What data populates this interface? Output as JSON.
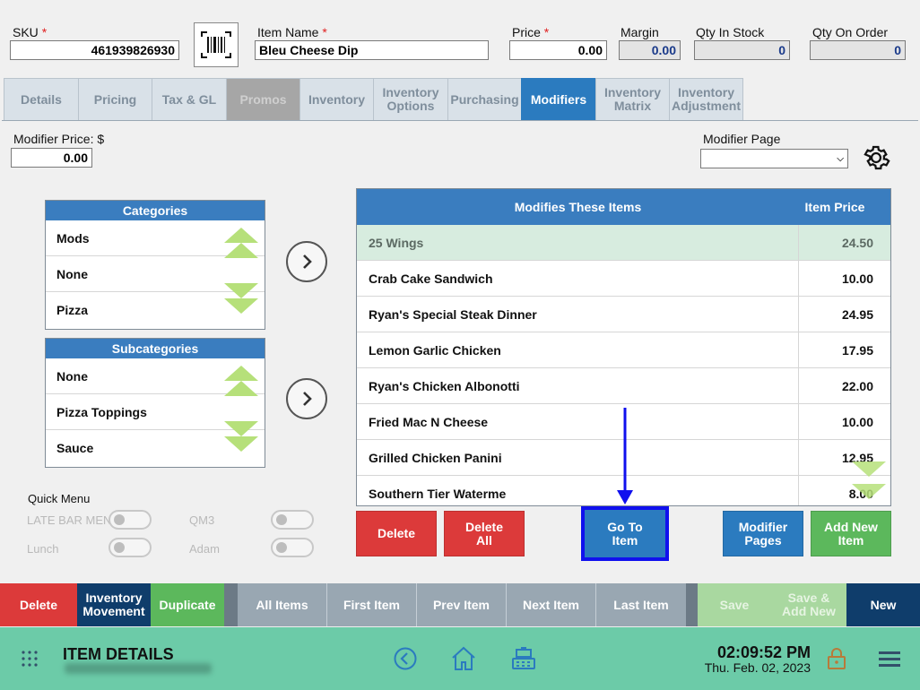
{
  "header": {
    "sku_label": "SKU",
    "sku_value": "461939826930",
    "item_name_label": "Item Name",
    "item_name_value": "Bleu Cheese Dip",
    "price_label": "Price",
    "price_value": "0.00",
    "margin_label": "Margin",
    "margin_value": "0.00",
    "qty_in_stock_label": "Qty In Stock",
    "qty_in_stock_value": "0",
    "qty_on_order_label": "Qty On Order",
    "qty_on_order_value": "0",
    "required_mark": "*"
  },
  "tabs": [
    {
      "label": "Details"
    },
    {
      "label": "Pricing"
    },
    {
      "label": "Tax & GL"
    },
    {
      "label": "Promos"
    },
    {
      "label": "Inventory"
    },
    {
      "label": "Inventory Options"
    },
    {
      "label": "Purchasing"
    },
    {
      "label": "Modifiers"
    },
    {
      "label": "Inventory Matrix"
    },
    {
      "label": "Inventory Adjustment"
    }
  ],
  "modifier": {
    "price_label": "Modifier Price: $",
    "price_value": "0.00",
    "page_label": "Modifier Page",
    "page_value": ""
  },
  "categories": {
    "title": "Categories",
    "items": [
      "Mods",
      "None",
      "Pizza"
    ]
  },
  "subcategories": {
    "title": "Subcategories",
    "items": [
      "None",
      "Pizza Toppings",
      "Sauce"
    ]
  },
  "quick_menu": {
    "title": "Quick Menu",
    "items": [
      "LATE BAR MENU",
      "QM3",
      "Lunch",
      "Adam"
    ]
  },
  "grid": {
    "col1": "Modifies These Items",
    "col2": "Item Price",
    "rows": [
      {
        "name": "25 Wings",
        "price": "24.50"
      },
      {
        "name": "Crab Cake Sandwich",
        "price": "10.00"
      },
      {
        "name": "Ryan's Special Steak Dinner",
        "price": "24.95"
      },
      {
        "name": "Lemon Garlic Chicken",
        "price": "17.95"
      },
      {
        "name": "Ryan's Chicken Albonotti",
        "price": "22.00"
      },
      {
        "name": "Fried Mac N Cheese",
        "price": "10.00"
      },
      {
        "name": "Grilled Chicken Panini",
        "price": "12.95"
      },
      {
        "name": "Southern Tier Waterme",
        "price": "8.00"
      }
    ]
  },
  "actions": {
    "delete": "Delete",
    "delete_all": "Delete All",
    "go_to_item": "Go To Item",
    "modifier_pages": "Modifier Pages",
    "add_new_item": "Add New Item"
  },
  "bottom_bar": {
    "delete": "Delete",
    "inventory_movement": "Inventory Movement",
    "duplicate": "Duplicate",
    "all_items": "All Items",
    "first_item": "First Item",
    "prev_item": "Prev Item",
    "next_item": "Next Item",
    "last_item": "Last Item",
    "save": "Save",
    "save_add_new": "Save & Add New",
    "new": "New"
  },
  "footer": {
    "title": "ITEM DETAILS",
    "time": "02:09:52 PM",
    "date": "Thu. Feb. 02, 2023"
  },
  "colors": {
    "accent_blue": "#2b7bbf",
    "delete_red": "#dc3a3a",
    "add_green": "#5cb85c",
    "footer_teal": "#6ccba8",
    "nav_navy": "#0f3d6b",
    "highlight_box": "#1010ee"
  }
}
